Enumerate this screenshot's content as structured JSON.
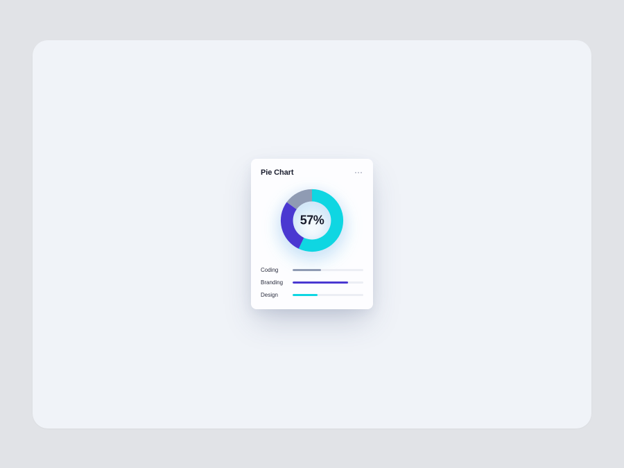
{
  "chart_data": {
    "type": "pie",
    "title": "Pie Chart",
    "center_label": "57%",
    "slices": [
      {
        "name": "Design",
        "value": 57,
        "color": "#0fd6e2"
      },
      {
        "name": "Branding",
        "value": 28,
        "color": "#4a38d1"
      },
      {
        "name": "Coding",
        "value": 15,
        "color": "#8f9bb3"
      }
    ],
    "legend": [
      {
        "label": "Coding",
        "percent": 40,
        "color": "#8f9bb3"
      },
      {
        "label": "Branding",
        "percent": 78,
        "color": "#4a38d1"
      },
      {
        "label": "Design",
        "percent": 35,
        "color": "#0fd6e2"
      }
    ]
  }
}
